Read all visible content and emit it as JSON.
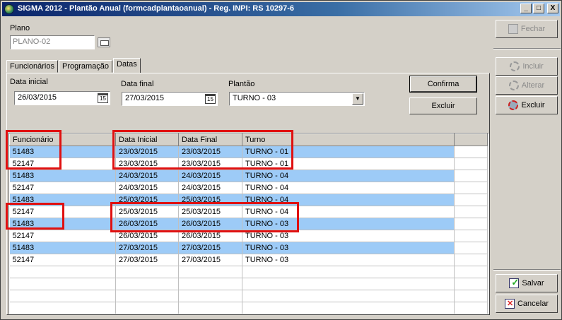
{
  "window": {
    "title": "SIGMA 2012 - Plantão Anual  (formcadplantaoanual)  - Reg. INPI: RS 10297-6",
    "minimize": "_",
    "maximize": "□",
    "close": "X"
  },
  "plano": {
    "label": "Plano",
    "value": "PLANO-02"
  },
  "tabs": [
    {
      "label": "Funcionários"
    },
    {
      "label": "Programação"
    },
    {
      "label": "Datas"
    }
  ],
  "filters": {
    "data_inicial_label": "Data inicial",
    "data_inicial_value": "26/03/2015",
    "data_final_label": "Data final",
    "data_final_value": "27/03/2015",
    "plantao_label": "Plantão",
    "plantao_value": "TURNO - 03",
    "calendar_glyph": "15"
  },
  "actions": {
    "confirma": "Confirma",
    "excluir": "Excluir"
  },
  "grid": {
    "headers": [
      "Funcionário",
      "Data Inicial",
      "Data Final",
      "Turno"
    ],
    "rows": [
      [
        "51483",
        "23/03/2015",
        "23/03/2015",
        "TURNO - 01"
      ],
      [
        "52147",
        "23/03/2015",
        "23/03/2015",
        "TURNO - 01"
      ],
      [
        "51483",
        "24/03/2015",
        "24/03/2015",
        "TURNO - 04"
      ],
      [
        "52147",
        "24/03/2015",
        "24/03/2015",
        "TURNO - 04"
      ],
      [
        "51483",
        "25/03/2015",
        "25/03/2015",
        "TURNO - 04"
      ],
      [
        "52147",
        "25/03/2015",
        "25/03/2015",
        "TURNO - 04"
      ],
      [
        "51483",
        "26/03/2015",
        "26/03/2015",
        "TURNO - 03"
      ],
      [
        "52147",
        "26/03/2015",
        "26/03/2015",
        "TURNO - 03"
      ],
      [
        "51483",
        "27/03/2015",
        "27/03/2015",
        "TURNO - 03"
      ],
      [
        "52147",
        "27/03/2015",
        "27/03/2015",
        "TURNO - 03"
      ]
    ],
    "empty_rows": 4,
    "row_highlight_color": "#9dcbf7"
  },
  "sidebar": {
    "fechar": "Fechar",
    "incluir": "Incluir",
    "alterar": "Alterar",
    "excluir": "Excluir",
    "salvar": "Salvar",
    "cancelar": "Cancelar"
  },
  "colors": {
    "annotation_red": "#e01010",
    "title_bar": "#0a246a"
  }
}
